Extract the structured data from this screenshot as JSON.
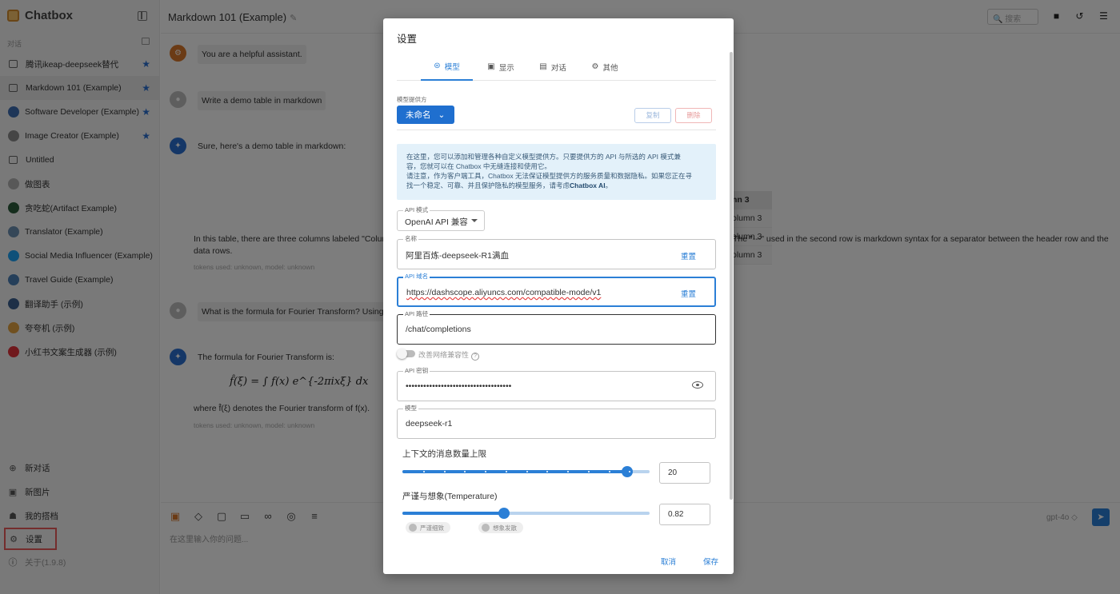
{
  "app": {
    "name": "Chatbox"
  },
  "sidebar": {
    "section_label": "对话",
    "conversations": [
      {
        "label": "腾讯ikeap-deepseek替代",
        "icon": "chat-bubble-icon",
        "starred": true,
        "active": false
      },
      {
        "label": "Markdown 101 (Example)",
        "icon": "chat-bubble-icon",
        "starred": true,
        "active": true
      },
      {
        "label": "Software Developer (Example)",
        "icon": "developer-avatar-icon",
        "starred": true,
        "active": false
      },
      {
        "label": "Image Creator (Example)",
        "icon": "image-creator-icon",
        "starred": true,
        "active": false
      },
      {
        "label": "Untitled",
        "icon": "chat-bubble-icon",
        "starred": false,
        "active": false
      },
      {
        "label": "做图表",
        "icon": "chart-avatar-icon",
        "starred": false,
        "active": false
      },
      {
        "label": "贪吃蛇(Artifact Example)",
        "icon": "snake-avatar-icon",
        "starred": false,
        "active": false
      },
      {
        "label": "Translator (Example)",
        "icon": "translator-avatar-icon",
        "starred": false,
        "active": false
      },
      {
        "label": "Social Media Influencer (Example)",
        "icon": "twitter-avatar-icon",
        "starred": false,
        "active": false
      },
      {
        "label": "Travel Guide (Example)",
        "icon": "globe-avatar-icon",
        "starred": false,
        "active": false
      },
      {
        "label": "翻译助手 (示例)",
        "icon": "translate-avatar-icon",
        "starred": false,
        "active": false
      },
      {
        "label": "夸夸机 (示例)",
        "icon": "praise-avatar-icon",
        "starred": false,
        "active": false
      },
      {
        "label": "小红书文案生成器 (示例)",
        "icon": "xiaohongshu-avatar-icon",
        "starred": false,
        "active": false
      }
    ],
    "bottom": {
      "new_chat": "新对话",
      "new_image": "新图片",
      "my_partners": "我的搭档",
      "settings": "设置",
      "about": "关于(1.9.8)"
    }
  },
  "topbar": {
    "title": "Markdown 101 (Example)",
    "search_placeholder": "搜索"
  },
  "messages": {
    "system": "You are a helpful assistant.",
    "user1": "Write a demo table in markdown",
    "assistant1_intro": "Sure, here's a demo table in markdown:",
    "table_header": "nn 3",
    "table_cells": [
      "olumn 3",
      "olumn 3",
      "olumn 3"
    ],
    "assistant1_tail_left": "In this table, there are three columns labeled \"Colum",
    "assistant1_tail_right": "The \"---\" used in the second row is markdown syntax for a separator between the header row and the",
    "assistant1_tail_line2": "data rows.",
    "meta1": "tokens used: unknown, model: unknown",
    "user2": "What is the formula for Fourier Transform? Using K",
    "assistant2_intro": "The formula for Fourier Transform is:",
    "assistant2_formula": "f̂(ξ) = ∫ f(x) e^{-2πixξ} dx",
    "assistant2_where": "where f̂(ξ) denotes the Fourier transform of f(x).",
    "meta2": "tokens used: unknown, model: unknown"
  },
  "input": {
    "placeholder": "在这里输入你的问题...",
    "model": "gpt-4o ◇"
  },
  "dialog": {
    "title": "设置",
    "tabs": [
      {
        "label": "模型",
        "icon": "robot-icon",
        "active": true
      },
      {
        "label": "显示",
        "icon": "display-icon",
        "active": false
      },
      {
        "label": "对话",
        "icon": "chat-icon",
        "active": false
      },
      {
        "label": "其他",
        "icon": "gear-icon",
        "active": false
      }
    ],
    "provider_caption": "模型提供方",
    "provider_value": "未命名",
    "copy_button": "复制",
    "delete_button": "删除",
    "info_line1": "在这里，您可以添加和管理各种自定义模型提供方。只要提供方的 API 与所选的 API 模式兼",
    "info_line2": "容，您就可以在 Chatbox 中无缝连接和使用它。",
    "info_line3": "请注意，作为客户端工具，Chatbox 无法保证模型提供方的服务质量和数据隐私。如果您正在寻",
    "info_line4_pre": "找一个稳定、可靠、并且保护隐私的模型服务，请考虑",
    "info_line4_bold": "Chatbox AI",
    "info_line4_post": "。",
    "api_mode_caption": "API 模式",
    "api_mode_value": "OpenAI API 兼容",
    "name_caption": "名称",
    "name_value": "阿里百炼-deepseek-R1满血",
    "reset_label": "重置",
    "api_host_caption": "API 域名",
    "api_host_value": "https://dashscope.aliyuncs.com/compatible-mode/v1",
    "api_path_caption": "API 路径",
    "api_path_value": "/chat/completions",
    "network_compat_label": "改善网络兼容性",
    "api_key_caption": "API 密钥",
    "api_key_value": "••••••••••••••••••••••••••••••••••••",
    "model_caption": "模型",
    "model_value": "deepseek-r1",
    "context_limit_label": "上下文的消息数量上限",
    "context_limit_value": "20",
    "context_limit_fraction": 0.91,
    "temperature_label": "严谨与想象(Temperature)",
    "temperature_value": "0.82",
    "temperature_fraction": 0.41,
    "chip_strict": "严谨细致",
    "chip_creative": "想象发散",
    "cancel": "取消",
    "save": "保存"
  },
  "colors": {
    "accent": "#2b7fd6",
    "settings_highlight": "#e95a5a"
  }
}
